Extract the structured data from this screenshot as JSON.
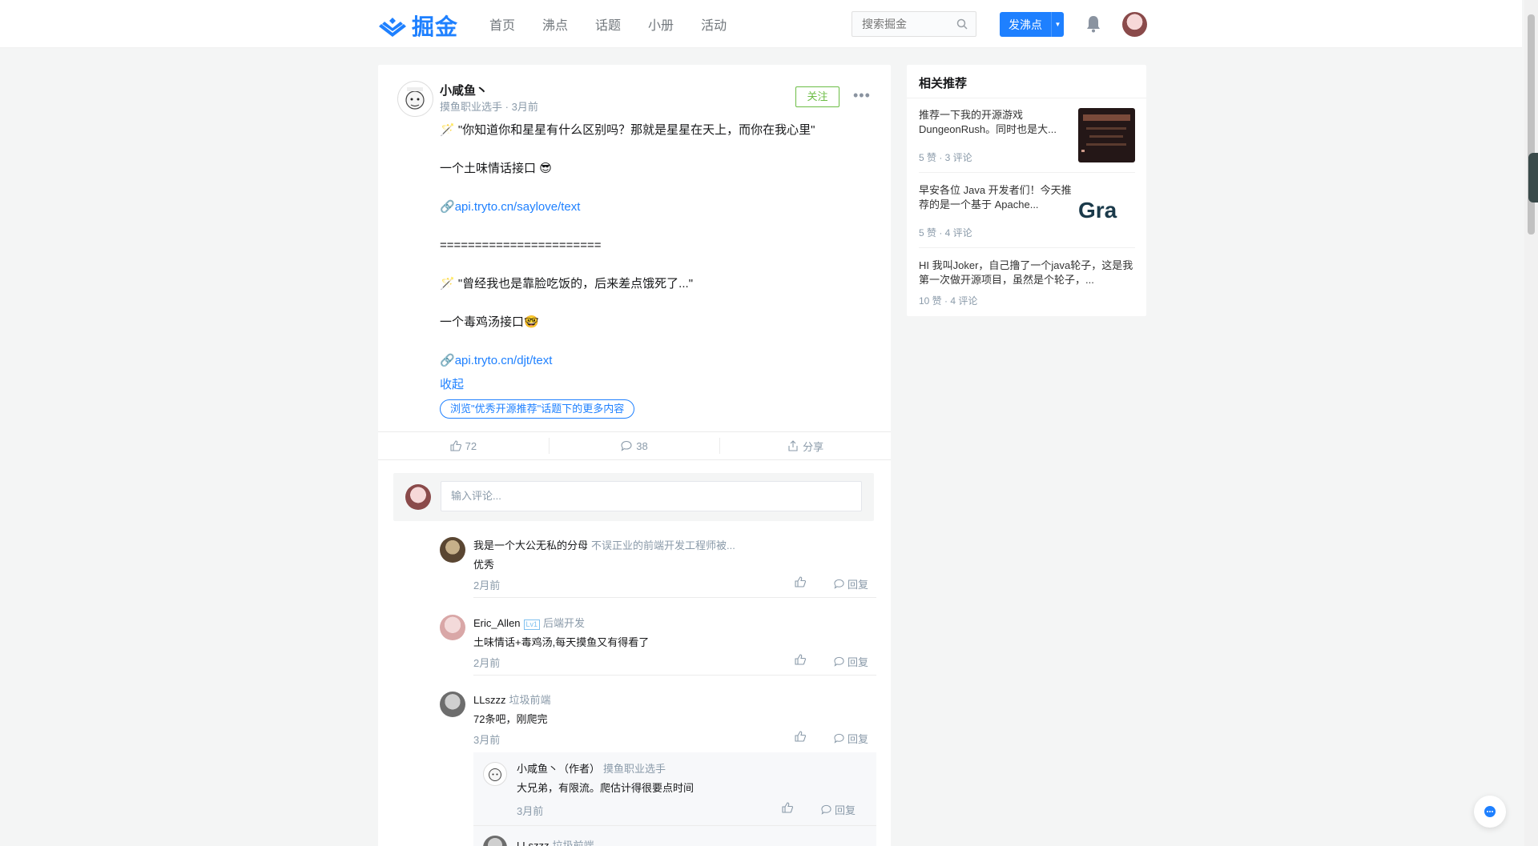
{
  "header": {
    "logo_text": "掘金",
    "nav": [
      "首页",
      "沸点",
      "话题",
      "小册",
      "活动"
    ],
    "search_placeholder": "搜索掘金",
    "post_button": "发沸点"
  },
  "post": {
    "author": "小咸鱼丶",
    "author_title": "摸鱼职业选手",
    "time": "3月前",
    "follow_label": "关注",
    "content": {
      "line1": "\"你知道你和星星有什么区别吗？那就是星星在天上，而你在我心里\"",
      "line2": "一个土味情话接口",
      "link1": "api.tryto.cn/saylove/text",
      "divider": "=======================",
      "line3": "\"曾经我也是靠脸吃饭的，后来差点饿死了...\"",
      "line4": "一个毒鸡汤接口",
      "link2": "api.tryto.cn/djt/text"
    },
    "collapse_label": "收起",
    "topic_tag": "浏览\"优秀开源推荐\"话题下的更多内容",
    "likes": "72",
    "comments": "38",
    "share_label": "分享"
  },
  "comment_input_placeholder": "输入评论...",
  "comments": [
    {
      "name": "我是一个大公无私的分母",
      "role": "不误正业的前端开发工程师被...",
      "text": "优秀",
      "time": "2月前",
      "reply": "回复"
    },
    {
      "name": "Eric_Allen",
      "level": "Lv1",
      "role": "后端开发",
      "text": "土味情话+毒鸡汤,每天摸鱼又有得看了",
      "time": "2月前",
      "reply": "回复"
    },
    {
      "name": "LLszzz",
      "role": "垃圾前端",
      "text": "72条吧，刚爬完",
      "time": "3月前",
      "reply": "回复"
    }
  ],
  "sub_comment": {
    "name": "小咸鱼丶（作者）",
    "role": "摸鱼职业选手",
    "text": "大兄弟，有限流。爬估计得很要点时间",
    "time": "3月前",
    "reply": "回复"
  },
  "sub_comment2": {
    "name": "LLszzz",
    "role": "垃圾前端"
  },
  "sidebar": {
    "title": "相关推荐",
    "items": [
      {
        "text": "推荐一下我的开源游戏DungeonRush。同时也是大...",
        "meta": "5 赞 · 3 评论"
      },
      {
        "text": "早安各位 Java 开发者们！今天推荐的是一个基于 Apache...",
        "meta": "5 赞 · 4 评论",
        "thumb_text": "Gra"
      },
      {
        "text": "HI 我叫Joker，自己撸了一个java轮子，这是我第一次做开源项目，虽然是个轮子，...",
        "meta": "10 赞 · 4 评论"
      }
    ]
  },
  "colors": {
    "brand": "#1e80ff",
    "follow": "#6cbd45",
    "muted": "#8a9aa9"
  }
}
